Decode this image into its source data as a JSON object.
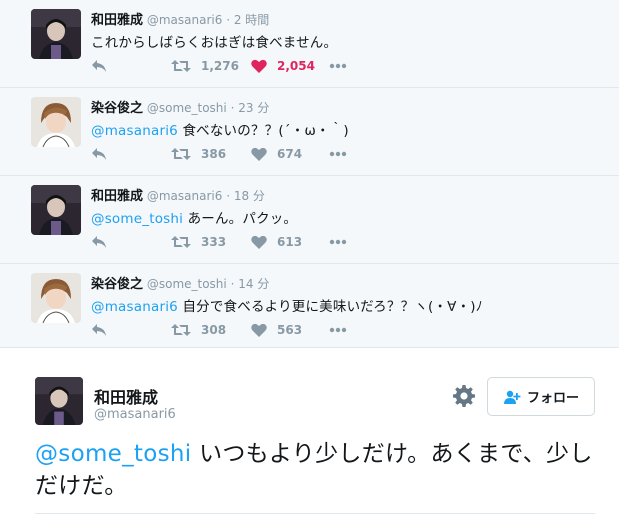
{
  "thread": [
    {
      "name": "和田雅成",
      "handle": "@masanari6",
      "dot": "·",
      "time": "2 時間",
      "mention": "",
      "text": "これからしばらくおはぎは食べません。",
      "retweets": "1,276",
      "likes": "2,054",
      "liked": true,
      "avatar": "masanari"
    },
    {
      "name": "染谷俊之",
      "handle": "@some_toshi",
      "dot": "·",
      "time": "23 分",
      "mention": "@masanari6",
      "text": " 食べないの？？(´・ω・｀)",
      "retweets": "386",
      "likes": "674",
      "liked": false,
      "avatar": "toshi"
    },
    {
      "name": "和田雅成",
      "handle": "@masanari6",
      "dot": "·",
      "time": "18 分",
      "mention": "@some_toshi",
      "text": " あーん。パクッ。",
      "retweets": "333",
      "likes": "613",
      "liked": false,
      "avatar": "masanari"
    },
    {
      "name": "染谷俊之",
      "handle": "@some_toshi",
      "dot": "·",
      "time": "14 分",
      "mention": "@masanari6",
      "text": " 自分で食べるより更に美味いだろ？？ヽ(・∀・)ﾉ",
      "retweets": "308",
      "likes": "563",
      "liked": false,
      "avatar": "toshi"
    }
  ],
  "main": {
    "name": "和田雅成",
    "handle": "@masanari6",
    "follow_label": "フォロー",
    "mention": "@some_toshi",
    "text": " いつもより少しだけ。あくまで、少しだけだ。"
  },
  "colors": {
    "mention": "#1da1f2",
    "like_active": "#e0245e",
    "muted": "#8899a6",
    "thread_bg": "#f5f8fa"
  },
  "icons": {
    "reply": "reply-icon",
    "retweet": "retweet-icon",
    "like": "heart-icon",
    "more": "more-icon",
    "settings": "gear-icon",
    "follow": "follow-person-icon"
  }
}
